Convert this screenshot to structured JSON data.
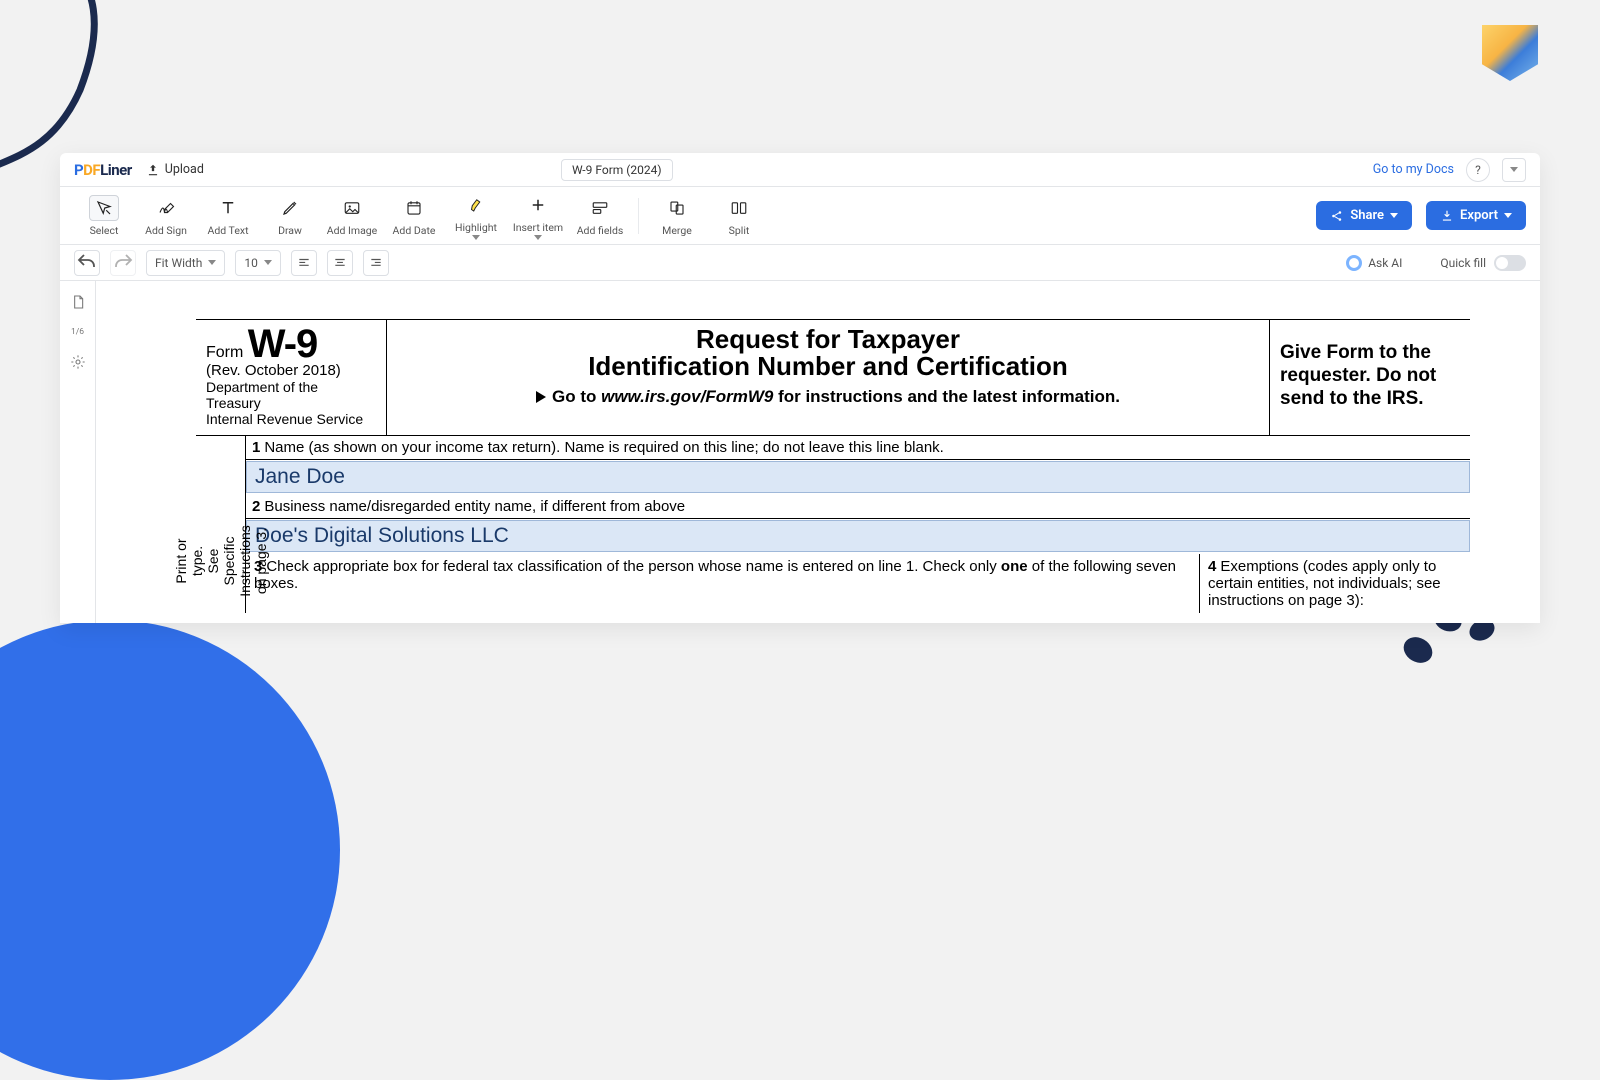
{
  "header": {
    "logo_pre": "P",
    "logo_mid": "DF",
    "logo_suf": "Liner",
    "upload": "Upload",
    "doc_title": "W-9 Form (2024)",
    "my_docs": "Go to my Docs",
    "help": "?"
  },
  "toolbar": {
    "select": "Select",
    "add_sign": "Add Sign",
    "add_text": "Add Text",
    "draw": "Draw",
    "add_image": "Add Image",
    "add_date": "Add Date",
    "highlight": "Highlight",
    "insert_item": "Insert item",
    "add_fields": "Add fields",
    "merge": "Merge",
    "split": "Split",
    "share": "Share",
    "export": "Export"
  },
  "subbar": {
    "fit": "Fit Width",
    "zoom": "10",
    "ask_ai": "Ask AI",
    "quick_fill": "Quick fill"
  },
  "rail": {
    "page": "1/6"
  },
  "form": {
    "form_word": "Form",
    "form_code": "W-9",
    "rev": "(Rev. October 2018)",
    "dept": "Department of the Treasury\nInternal Revenue Service",
    "title1": "Request for Taxpayer",
    "title2": "Identification Number and Certification",
    "goto_pre": "Go to ",
    "goto_url": "www.irs.gov/FormW9",
    "goto_post": " for instructions and the latest information.",
    "give": "Give Form to the requester. Do not send to the IRS.",
    "side": "Print or type.\nSee Specific Instructions on page 3.",
    "line1_label": "Name (as shown on your income tax return). Name is required on this line; do not leave this line blank.",
    "line1_value": "Jane Doe",
    "line2_label": "Business name/disregarded entity name, if different from above",
    "line2_value": "Doe's Digital Solutions LLC",
    "line3_pre": "Check appropriate box for federal tax classification of the person whose name is entered on line 1. Check only ",
    "line3_one": "one",
    "line3_post": " of the following seven boxes.",
    "line4": "Exemptions (codes apply only to certain entities, not individuals; see instructions on page 3):"
  }
}
